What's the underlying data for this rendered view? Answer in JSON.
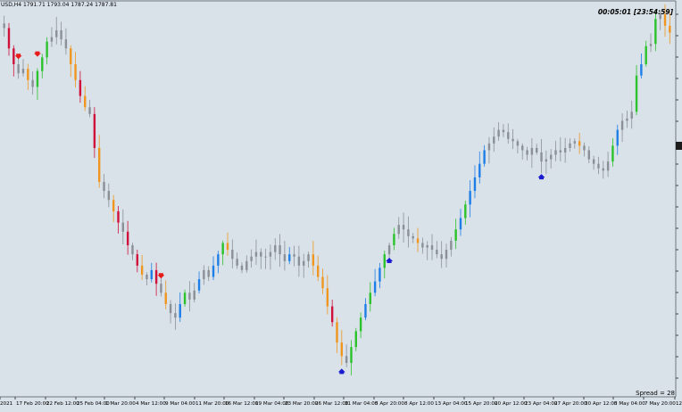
{
  "header": {
    "symbol_info": "USD,H4  1791.71  1793.04  1787.24  1787.81",
    "server_time": "00:05:01 [23:54:59]"
  },
  "footer": {
    "spread": "Spread = 28"
  },
  "colors": {
    "background": "#d9e2e9",
    "candle_neutral": "#8a9096",
    "candle_red": "#d0103a",
    "candle_orange": "#f0961e",
    "candle_green": "#2cc22c",
    "candle_blue": "#1e7ee8",
    "arrow_down": "#e81b1b",
    "arrow_up": "#1a1ad0"
  },
  "chart_data": {
    "type": "candlestick",
    "x_tick_labels": [
      "2021",
      "17 Feb 20:00",
      "22 Feb 12:00",
      "25 Feb 04:00",
      "1 Mar 20:00",
      "4 Mar 12:00",
      "9 Mar 04:00",
      "11 Mar 20:00",
      "16 Mar 12:00",
      "19 Mar 04:00",
      "23 Mar 20:00",
      "26 Mar 12:00",
      "31 Mar 04:00",
      "5 Apr 20:00",
      "8 Apr 12:00",
      "13 Apr 04:00",
      "15 Apr 20:00",
      "20 Apr 12:00",
      "23 Apr 04:00",
      "27 Apr 20:00",
      "30 Apr 12:00",
      "5 May 04:00",
      "7 May 20:00",
      "12 M"
    ],
    "close_series": [
      1838,
      1829,
      1822,
      1818,
      1820,
      1815,
      1812,
      1819,
      1825,
      1832,
      1834,
      1837,
      1833,
      1829,
      1822,
      1815,
      1808,
      1803,
      1800,
      1785,
      1770,
      1766,
      1762,
      1757,
      1752,
      1748,
      1742,
      1738,
      1733,
      1729,
      1727,
      1731,
      1725,
      1721,
      1716,
      1712,
      1710,
      1716,
      1721,
      1718,
      1722,
      1727,
      1731,
      1728,
      1733,
      1738,
      1743,
      1740,
      1736,
      1733,
      1731,
      1735,
      1737,
      1739,
      1737,
      1737,
      1739,
      1742,
      1738,
      1735,
      1738,
      1737,
      1733,
      1735,
      1738,
      1733,
      1728,
      1723,
      1715,
      1708,
      1699,
      1693,
      1690,
      1697,
      1704,
      1710,
      1716,
      1721,
      1726,
      1732,
      1738,
      1742,
      1747,
      1751,
      1749,
      1746,
      1745,
      1743,
      1741,
      1742,
      1740,
      1738,
      1736,
      1740,
      1744,
      1749,
      1754,
      1760,
      1766,
      1772,
      1778,
      1784,
      1787,
      1790,
      1793,
      1792,
      1789,
      1788,
      1786,
      1784,
      1782,
      1785,
      1783,
      1779,
      1780,
      1782,
      1784,
      1783,
      1785,
      1787,
      1788,
      1786,
      1784,
      1780,
      1778,
      1776,
      1775,
      1779,
      1786,
      1793,
      1797,
      1798,
      1801,
      1817,
      1822,
      1830,
      1831,
      1842,
      1844,
      1839,
      1836
    ],
    "buy_signal_indices": [
      71,
      81,
      113
    ],
    "sell_signal_indices": [
      3,
      7,
      33
    ],
    "price_range": [
      1675,
      1850
    ]
  }
}
